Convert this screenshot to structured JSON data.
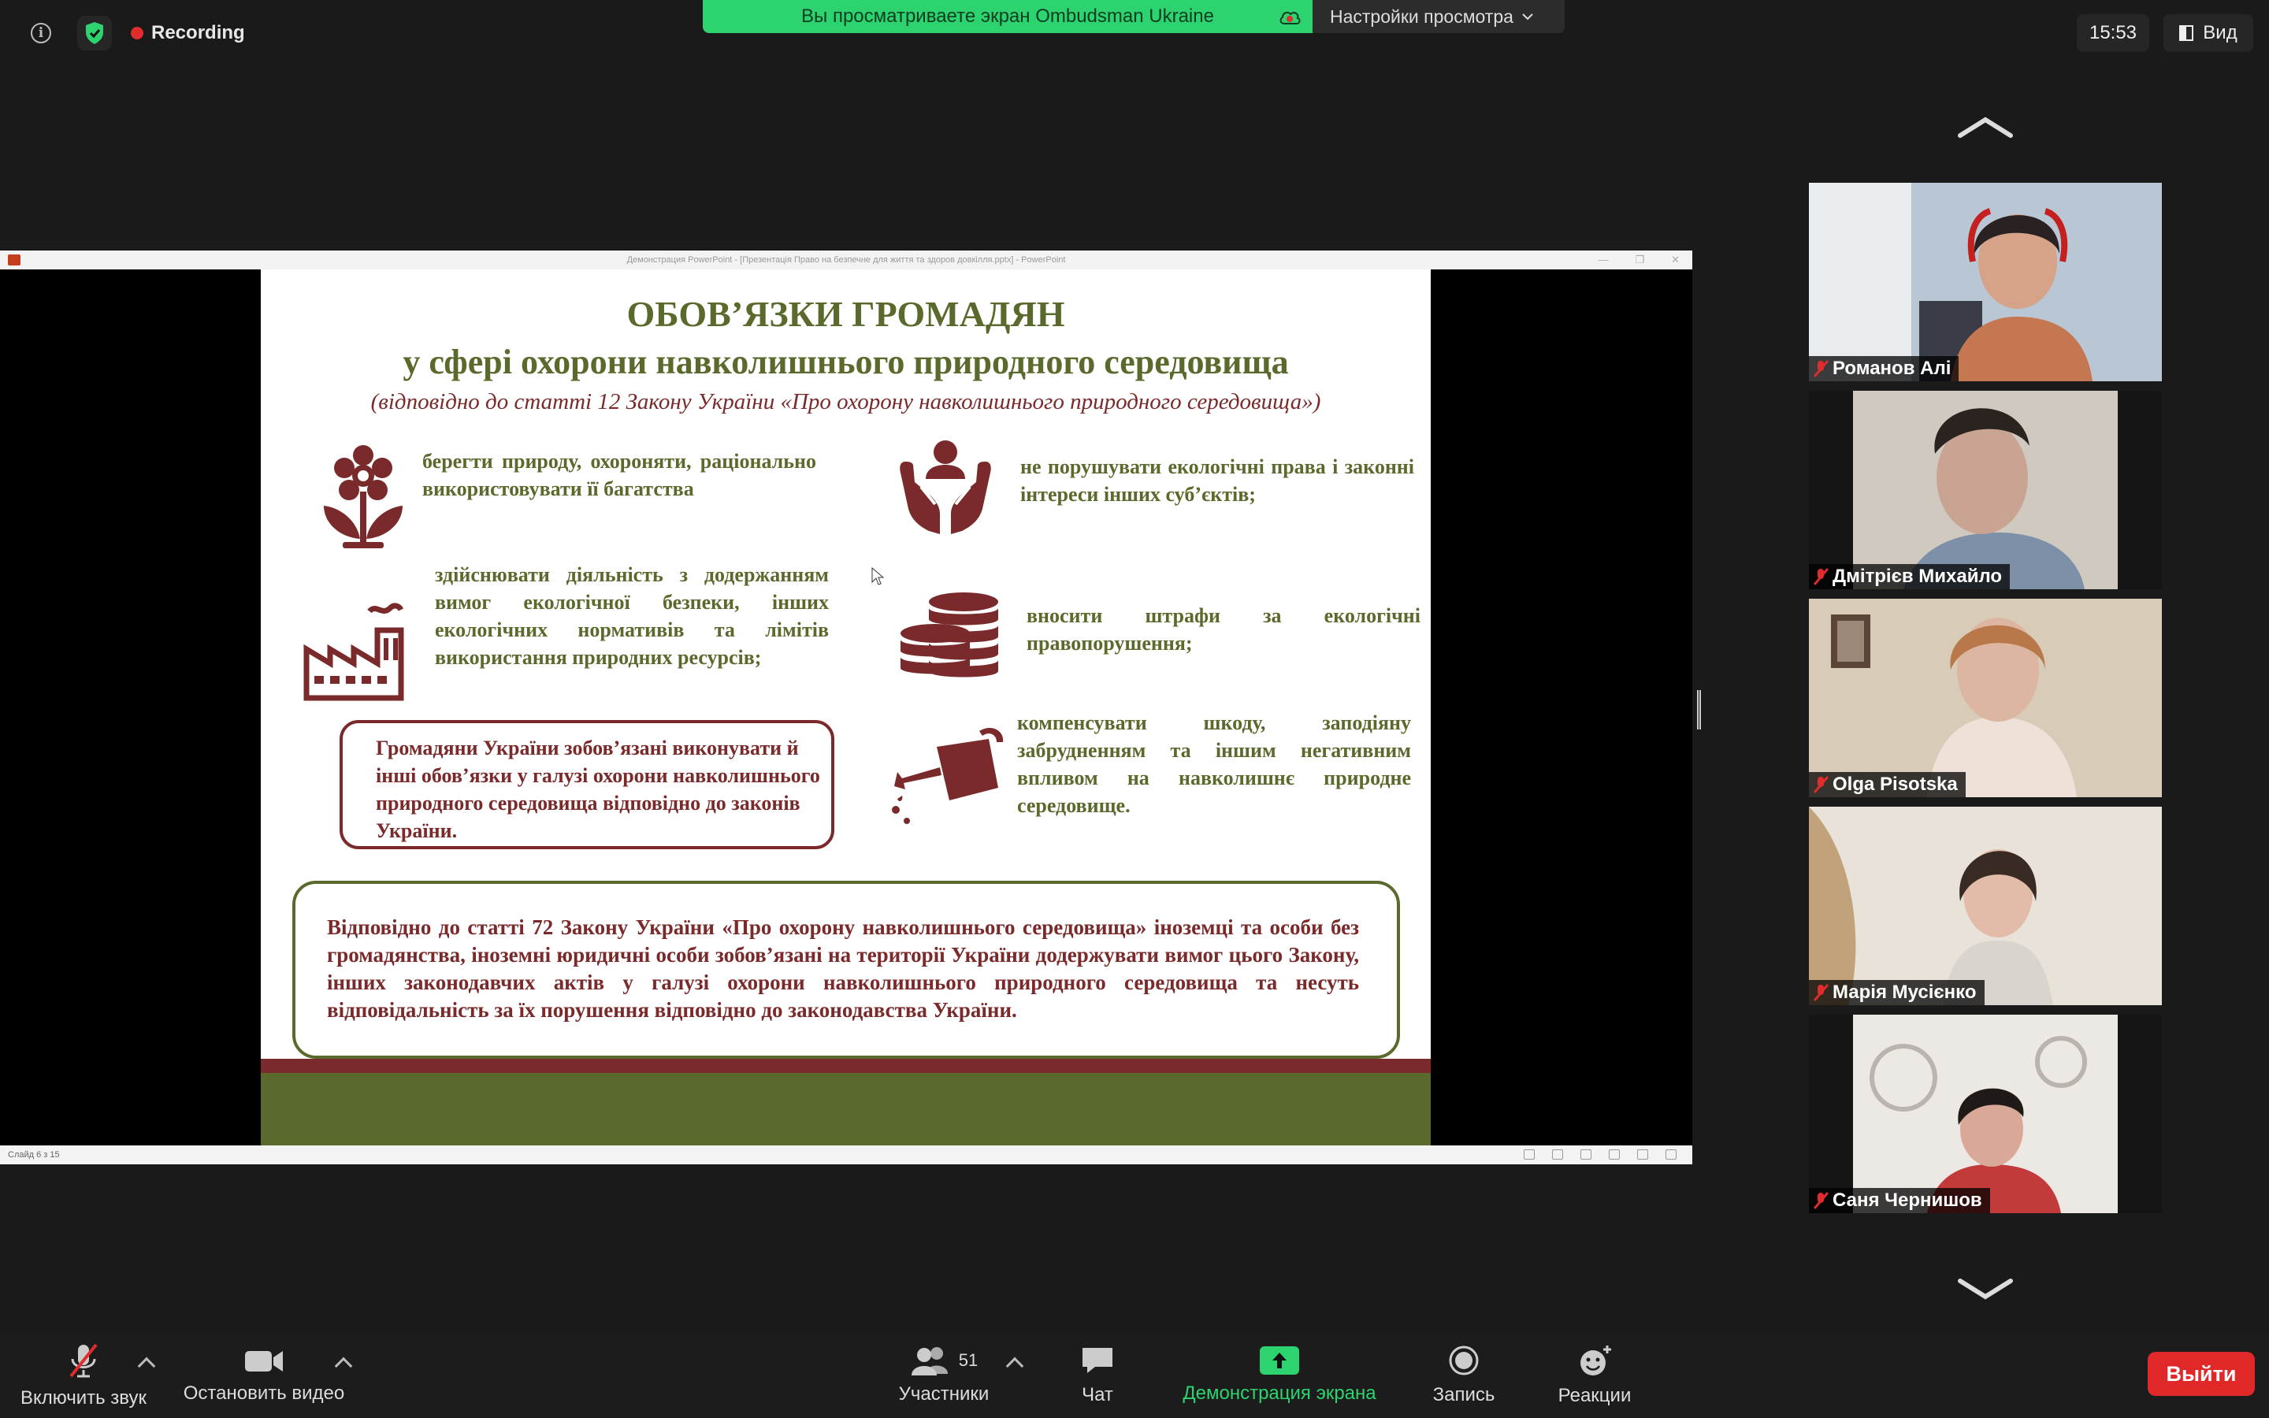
{
  "top_bar": {
    "recording_label": "Recording",
    "share_banner_text": "Вы просматриваете экран Ombudsman Ukraine",
    "view_options_label": "Настройки просмотра",
    "clock": "15:53",
    "view_button_label": "Вид"
  },
  "shared_window": {
    "title": "Демонстрация PowerPoint - [Презентація Право на безпечне для життя та здоров довкілля.pptx] - PowerPoint",
    "status": "Слайд 6 з 15"
  },
  "slide": {
    "title_line1": "ОБОВ’ЯЗКИ ГРОМАДЯН",
    "title_line2": "у сфері охорони навколишнього природного середовища",
    "subtitle": "(відповідно до статті 12 Закону України «Про охорону навколишнього природного середовища»)",
    "item_nature": "берегти природу, охороняти, раціонально використовувати її багатства",
    "item_rights": "не порушувати екологічні права і законні інтереси інших суб’єктів;",
    "item_activity": "здійснювати діяльність з додержанням вимог екологічної безпеки, інших екологічних нормативів та лімітів використання природних ресурсів;",
    "item_fines": "вносити штрафи за екологічні правопорушення;",
    "item_compensate": "компенсувати шкоду, заподіяну забрудненням та іншим негативним впливом на навколишнє природне середовище.",
    "box_other_duties": "Громадяни України зобов’язані виконувати й інші обов’язки у галузі охорони навколишнього природного середовища відповідно до законів України.",
    "box_foreigners": "Відповідно до статті 72 Закону України «Про охорону навколишнього середовища» іноземці та особи без громадянства, іноземні юридичні особи зобов’язані на території України додержувати вимог цього Закону, інших законодавчих актів у галузі охорони навколишнього природного середовища та несуть відповідальність за їх порушення відповідно до законодавства України."
  },
  "participants": [
    {
      "name": "Романов Алі"
    },
    {
      "name": "Дмітрієв Михайло"
    },
    {
      "name": "Olga Pisotska"
    },
    {
      "name": "Марія Мусієнко"
    },
    {
      "name": "Саня Чернишов"
    }
  ],
  "toolbar": {
    "unmute_label": "Включить звук",
    "stop_video_label": "Остановить видео",
    "participants_label": "Участники",
    "participants_count": "51",
    "chat_label": "Чат",
    "share_label": "Демонстрация экрана",
    "record_label": "Запись",
    "reactions_label": "Реакции",
    "leave_label": "Выйти"
  },
  "colors": {
    "share_green": "#2dd36f",
    "leave_red": "#e02828",
    "slide_olive": "#5a6a2c",
    "slide_maroon": "#7a2a2a"
  }
}
